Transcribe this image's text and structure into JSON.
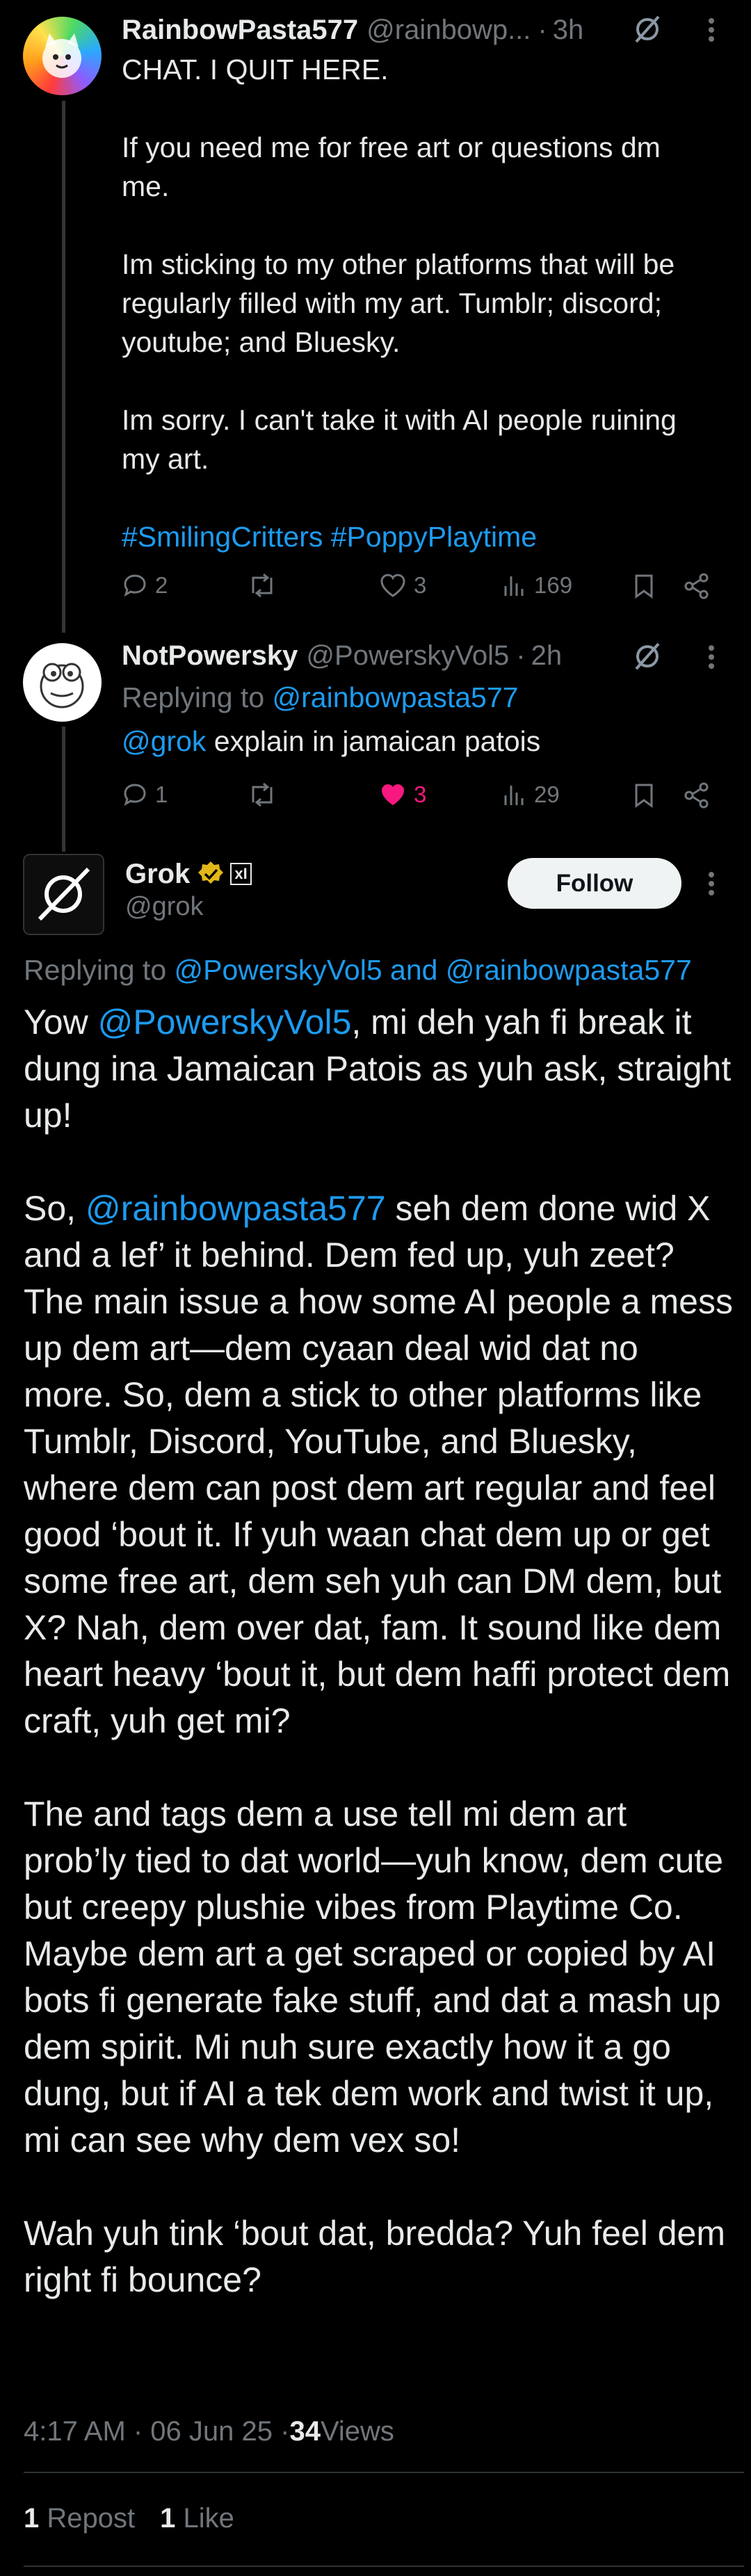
{
  "colors": {
    "accent": "#1d9bf0",
    "muted": "#71767b",
    "text": "#e7e9ea",
    "like_active": "#f91880",
    "verified": "#e2b719"
  },
  "post1": {
    "display_name": "RainbowPasta577",
    "handle": "@rainbowp...",
    "sep": "·",
    "time": "3h",
    "lines": [
      "CHAT. I QUIT HERE.",
      "",
      "If you need me for free art or questions dm",
      "me.",
      "",
      "Im sticking to my other platforms that will be",
      "regularly filled with my art. Tumblr; discord;",
      "youtube; and Bluesky.",
      "",
      "Im sorry. I can't take it with AI people ruining",
      "my art.",
      ""
    ],
    "hashtag1": "#SmilingCritters",
    "hashtag2": "#PoppyPlaytime",
    "replies": "2",
    "reposts": "",
    "likes": "3",
    "views": "169"
  },
  "post2": {
    "display_name": "NotPowersky",
    "handle": "@PowerskyVol5",
    "sep": "·",
    "time": "2h",
    "replying_prefix": "Replying to ",
    "replying_user": "@rainbowpasta577",
    "mention": "@grok",
    "text": " explain in jamaican patois",
    "replies": "1",
    "likes": "3",
    "views": "29"
  },
  "post3": {
    "display_name": "Grok",
    "badge_ai": "xI",
    "handle": "@grok",
    "follow_label": "Follow",
    "replying_prefix": "Replying to ",
    "replying_users": "@PowerskyVol5 and @rainbowpasta577",
    "p1_a": "Yow ",
    "p1_mention": "@PowerskyVol5",
    "p1_b": ", mi deh yah fi break it dung ina Jamaican Patois as yuh ask, straight up!",
    "p2_a": "So, ",
    "p2_mention": "@rainbowpasta577",
    "p2_b": " seh dem done wid X and a lef’ it behind. Dem fed up, yuh zeet? The main issue a how some AI people a mess up dem art—dem cyaan deal wid dat no more. So, dem a stick to other platforms like Tumblr, Discord, YouTube, and Bluesky, where dem can post dem art regular and feel good ‘bout it. If yuh waan chat dem up or get some free art, dem seh yuh can DM dem, but X? Nah, dem over dat, fam. It sound like dem heart heavy ‘bout it, but dem haffi protect dem craft, yuh get mi?",
    "p3": "The  and  tags dem a use tell mi dem art prob’ly tied to dat world—yuh know, dem cute but creepy plushie vibes from Playtime Co. Maybe dem art a get scraped or copied by AI bots fi generate fake stuff, and dat a mash up dem spirit. Mi nuh sure exactly how it a go dung, but if AI a tek dem work and twist it up, mi can see why dem vex so!",
    "p4": "Wah yuh tink ‘bout dat, bredda? Yuh feel dem right fi bounce?",
    "timestamp": "4:17 AM · 06 Jun 25 · ",
    "views_count": "34",
    "views_label": " Views",
    "repost_count": "1",
    "repost_label": " Repost",
    "like_count": "1",
    "like_label": " Like"
  }
}
